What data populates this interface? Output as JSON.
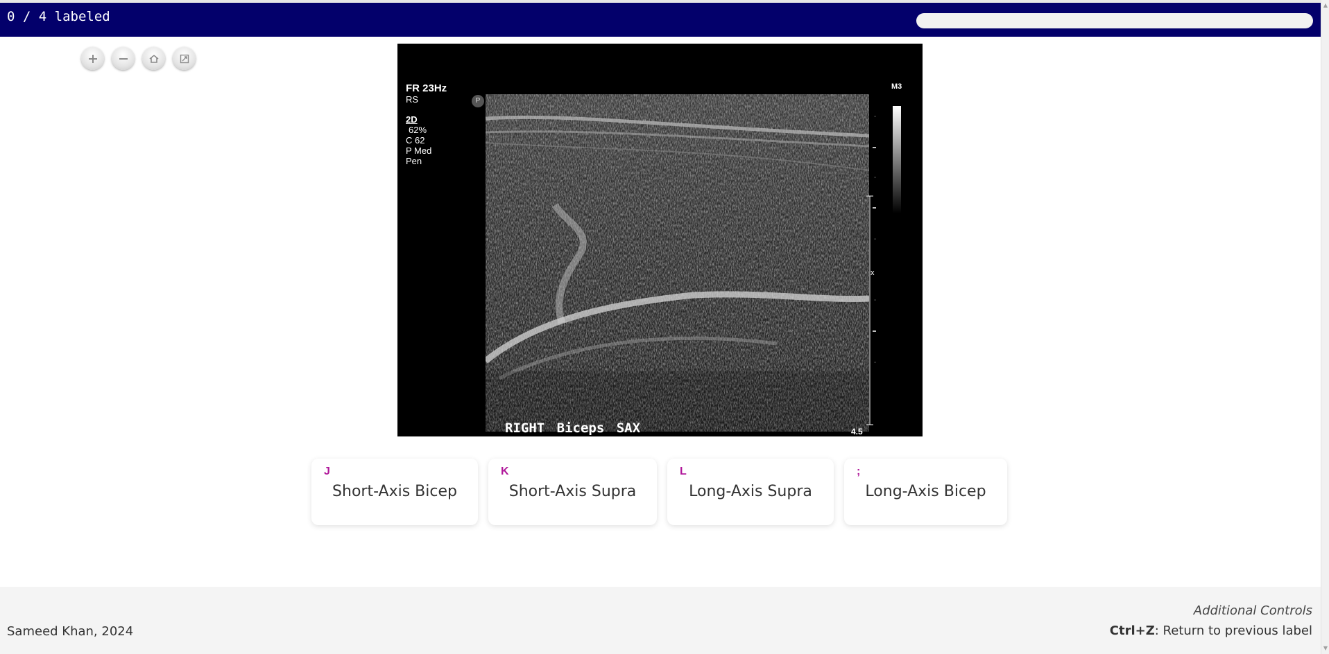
{
  "header": {
    "progress_text": "0 / 4 labeled",
    "progress_fraction": 0.0,
    "background": "#03006b"
  },
  "tools": [
    {
      "name": "zoom-in",
      "icon": "plus-icon"
    },
    {
      "name": "zoom-out",
      "icon": "minus-icon"
    },
    {
      "name": "home",
      "icon": "home-icon"
    },
    {
      "name": "full-page",
      "icon": "fullscreen-icon"
    }
  ],
  "viewer": {
    "frame_rate": "FR 23Hz",
    "rs": "RS",
    "mode": "2D",
    "gain": "62%",
    "c_value": "C 62",
    "p_value": "P Med",
    "pen": "Pen",
    "probe_marker": "P",
    "map": "M3",
    "depth": "4.5",
    "caption": "RIGHT  Biceps  SAX"
  },
  "labels": [
    {
      "key": "J",
      "text": "Short-Axis Bicep"
    },
    {
      "key": "K",
      "text": "Short-Axis Supra"
    },
    {
      "key": "L",
      "text": "Long-Axis Supra"
    },
    {
      "key": ";",
      "text": "Long-Axis Bicep"
    }
  ],
  "footer": {
    "author": "Sameed Khan, 2024",
    "controls_title": "Additional Controls",
    "controls_key": "Ctrl+Z",
    "controls_desc": ": Return to previous label"
  },
  "colors": {
    "accent_key": "#b0179a",
    "header_bg": "#03006b"
  }
}
